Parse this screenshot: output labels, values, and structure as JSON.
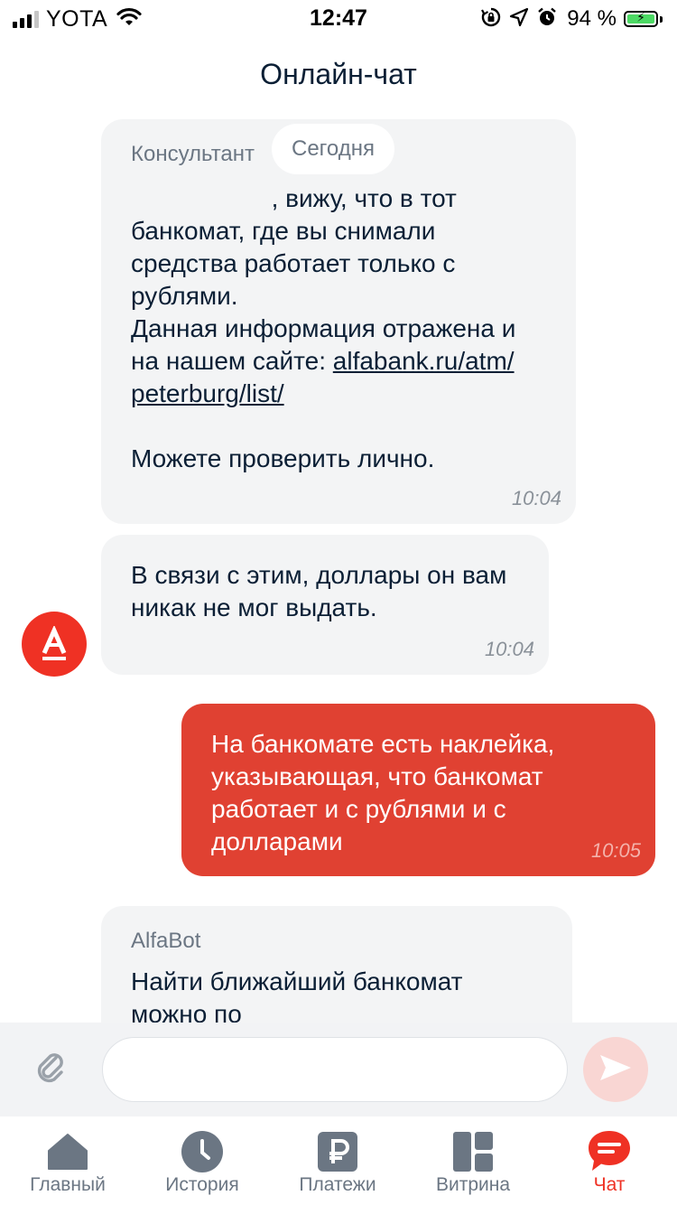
{
  "status_bar": {
    "carrier": "YOTA",
    "time": "12:47",
    "battery": "94 %"
  },
  "header": {
    "title": "Онлайн-чат"
  },
  "chat": {
    "date_separator": "Сегодня",
    "messages": [
      {
        "sender": "Консультант",
        "text_before_link": "                    , вижу, что в тот банкомат, где вы снимали средства работает только с рублями.\nДанная информация отражена и на нашем сайте: ",
        "link_line1": "alfabank.ru/atm/",
        "link_line2": "peterburg/list/",
        "text_after_link": "\n\nМожете проверить лично.",
        "time": "10:04"
      },
      {
        "text": "В связи с этим, доллары он вам никак не мог выдать.",
        "time": "10:04"
      },
      {
        "text": "На банкомате есть наклейка, указывающая, что банкомат работает и с рублями и с долларами",
        "time": "10:05"
      },
      {
        "sender": "AlfaBot",
        "text": "Найти ближайший банкомат можно по"
      }
    ]
  },
  "input_bar": {
    "placeholder": ""
  },
  "tabs": [
    {
      "label": "Главный"
    },
    {
      "label": "История"
    },
    {
      "label": "Платежи"
    },
    {
      "label": "Витрина"
    },
    {
      "label": "Чат"
    }
  ],
  "icons": {
    "attach": "paperclip-icon",
    "send": "send-icon",
    "avatar": "alfa-logo-icon"
  },
  "colors": {
    "brand_red": "#ef3124",
    "user_bubble": "#e04132",
    "bot_bubble": "#f3f4f5",
    "send_disabled": "#f9d6d3",
    "battery_green": "#4cd964"
  }
}
